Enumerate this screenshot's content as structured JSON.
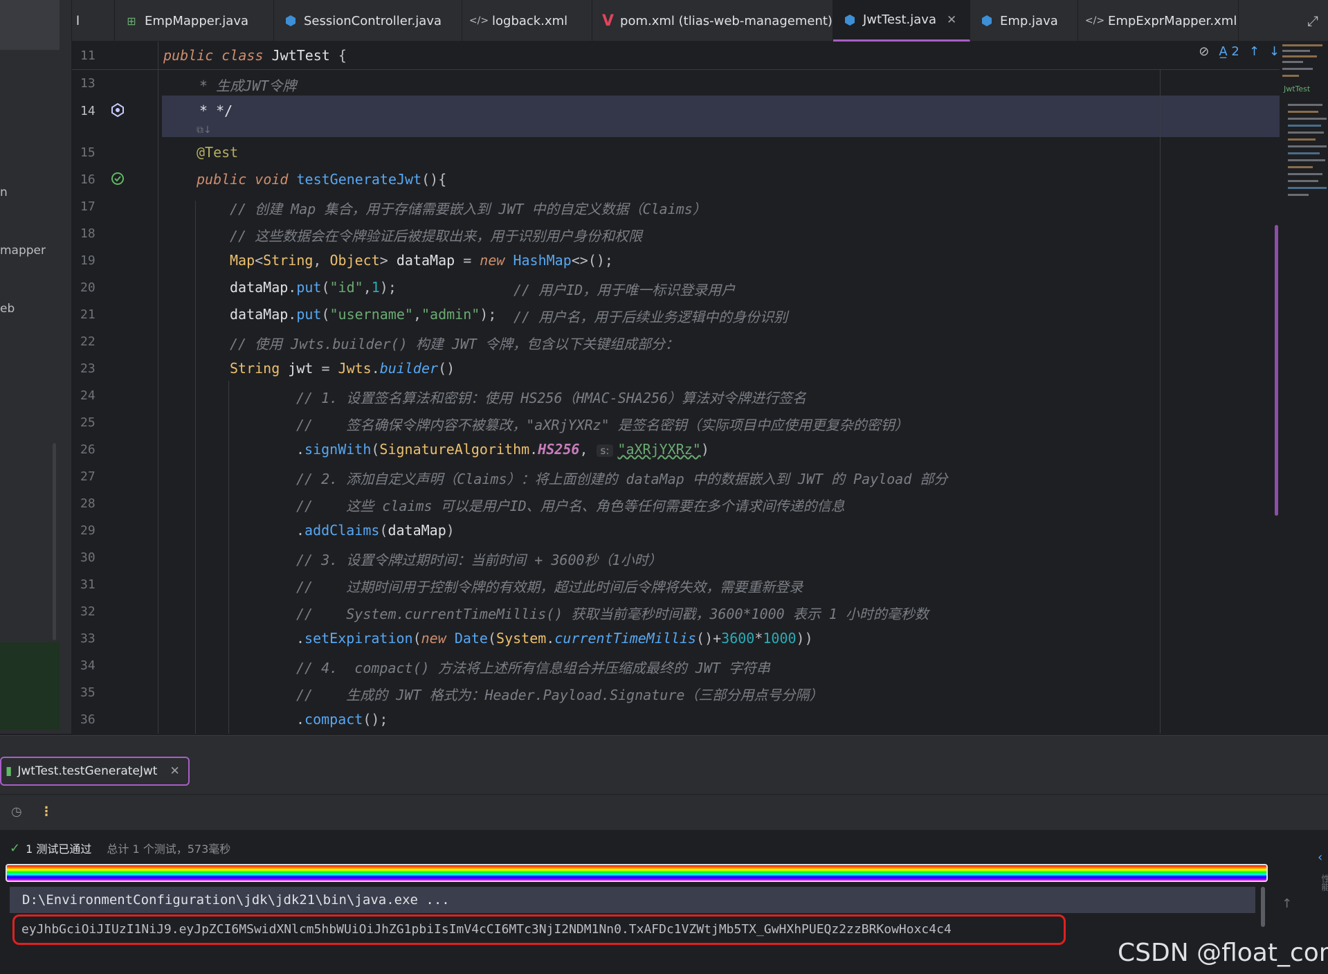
{
  "project_panel": {
    "fragments": [
      "n",
      "mapper",
      "eb"
    ]
  },
  "tabs": [
    {
      "label": "EmpMapper.java",
      "icon": "mapper-icon"
    },
    {
      "label": "SessionController.java",
      "icon": "class-icon"
    },
    {
      "label": "logback.xml",
      "icon": "xml-icon"
    },
    {
      "label": "pom.xml (tlias-web-management)",
      "icon": "maven-icon"
    },
    {
      "label": "JwtTest.java",
      "icon": "class-icon",
      "active": true
    },
    {
      "label": "Emp.java",
      "icon": "class-icon"
    },
    {
      "label": "EmpExprMapper.xml",
      "icon": "xml-icon"
    }
  ],
  "tab_fragment_left": "l",
  "editor": {
    "sticky": {
      "line": "11",
      "text": "public class JwtTest {"
    },
    "inspection_count": "2",
    "minimap_label": "JwtTest",
    "lines": [
      {
        "n": "13",
        "code": "* 生成JWT令牌"
      },
      {
        "n": "14",
        "code": "* */"
      },
      {
        "n": "15",
        "code": "@Test"
      },
      {
        "n": "16",
        "code": "public void testGenerateJwt(){"
      },
      {
        "n": "17",
        "code": "// 创建 Map 集合，用于存储需要嵌入到 JWT 中的自定义数据（Claims）"
      },
      {
        "n": "18",
        "code": "// 这些数据会在令牌验证后被提取出来，用于识别用户身份和权限"
      },
      {
        "n": "19",
        "code": "Map<String, Object> dataMap = new HashMap<>();"
      },
      {
        "n": "20",
        "code": "dataMap.put(\"id\",1);",
        "comment": "// 用户ID，用于唯一标识登录用户"
      },
      {
        "n": "21",
        "code": "dataMap.put(\"username\",\"admin\");",
        "comment": "// 用户名，用于后续业务逻辑中的身份识别"
      },
      {
        "n": "22",
        "code": "// 使用 Jwts.builder() 构建 JWT 令牌，包含以下关键组成部分："
      },
      {
        "n": "23",
        "code": "String jwt = Jwts.builder()"
      },
      {
        "n": "24",
        "code": "// 1. 设置签名算法和密钥：使用 HS256（HMAC-SHA256）算法对令牌进行签名"
      },
      {
        "n": "25",
        "code": "//    签名确保令牌内容不被篡改，\"aXRjYXRz\" 是签名密钥（实际项目中应使用更复杂的密钥）"
      },
      {
        "n": "26",
        "code": ".signWith(SignatureAlgorithm.HS256, ",
        "hint": "s:",
        "tail": "\"aXRjYXRz\")"
      },
      {
        "n": "27",
        "code": "// 2. 添加自定义声明（Claims）：将上面创建的 dataMap 中的数据嵌入到 JWT 的 Payload 部分"
      },
      {
        "n": "28",
        "code": "//    这些 claims 可以是用户ID、用户名、角色等任何需要在多个请求间传递的信息"
      },
      {
        "n": "29",
        "code": ".addClaims(dataMap)"
      },
      {
        "n": "30",
        "code": "// 3. 设置令牌过期时间：当前时间 + 3600秒（1小时）"
      },
      {
        "n": "31",
        "code": "//    过期时间用于控制令牌的有效期，超过此时间后令牌将失效，需要重新登录"
      },
      {
        "n": "32",
        "code": "//    System.currentTimeMillis() 获取当前毫秒时间戳，3600*1000 表示 1 小时的毫秒数"
      },
      {
        "n": "33",
        "code": ".setExpiration(new Date(System.currentTimeMillis()+3600*1000))"
      },
      {
        "n": "34",
        "code": "// 4.  compact() 方法将上述所有信息组合并压缩成最终的 JWT 字符串"
      },
      {
        "n": "35",
        "code": "//    生成的 JWT 格式为：Header.Payload.Signature（三部分用点号分隔）"
      },
      {
        "n": "36",
        "code": ".compact();"
      }
    ]
  },
  "run": {
    "tab_label": "JwtTest.testGenerateJwt",
    "status_passed": "1 测试已通过",
    "status_total": "总计 1 个测试，573毫秒",
    "console": [
      "D:\\EnvironmentConfiguration\\jdk\\jdk21\\bin\\java.exe ...",
      "eyJhbGciOiJIUzI1NiJ9.eyJpZCI6MSwidXNlcm5hbWUiOiJhZG1pbiIsImV4cCI6MTc3NjI2NDM1Nn0.TxAFDc1VZWtjMb5TX_GwHXhPUEQz2zzBRKowHoxc4c4"
    ],
    "side_label": "性能"
  },
  "watermark": "CSDN @float_com",
  "colors": {
    "accent": "#a95ec7",
    "highlight_box": "#e02020",
    "pass": "#5fb865"
  }
}
